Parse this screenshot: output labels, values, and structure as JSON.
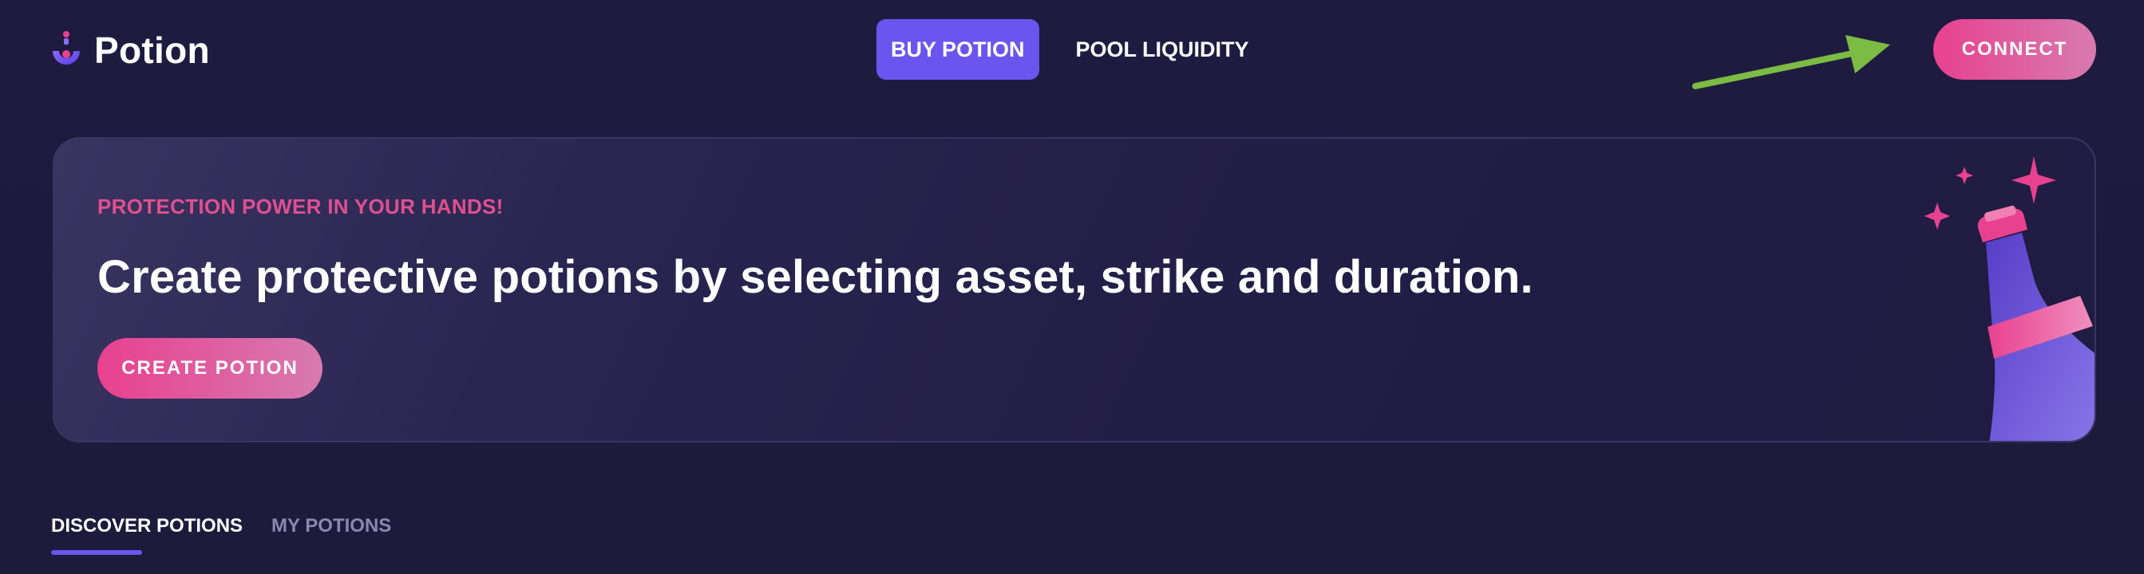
{
  "header": {
    "brand": "Potion",
    "nav": [
      {
        "label": "BUY POTION",
        "active": true
      },
      {
        "label": "POOL LIQUIDITY",
        "active": false
      }
    ],
    "connect_label": "CONNECT"
  },
  "hero": {
    "eyebrow": "PROTECTION POWER IN YOUR HANDS!",
    "title": "Create protective potions by selecting asset, strike and duration.",
    "cta_label": "CREATE POTION"
  },
  "tabs": [
    {
      "label": "DISCOVER POTIONS",
      "active": true
    },
    {
      "label": "MY POTIONS",
      "active": false
    }
  ],
  "colors": {
    "accent": "#6c55ee",
    "pink": "#e8418f",
    "background": "#1e1a3d",
    "arrow": "#7cbb44"
  },
  "icons": {
    "logo": "potion-flask-logo-icon",
    "annotation": "green-arrow-icon",
    "illustration": "potion-bottle-illustration"
  }
}
